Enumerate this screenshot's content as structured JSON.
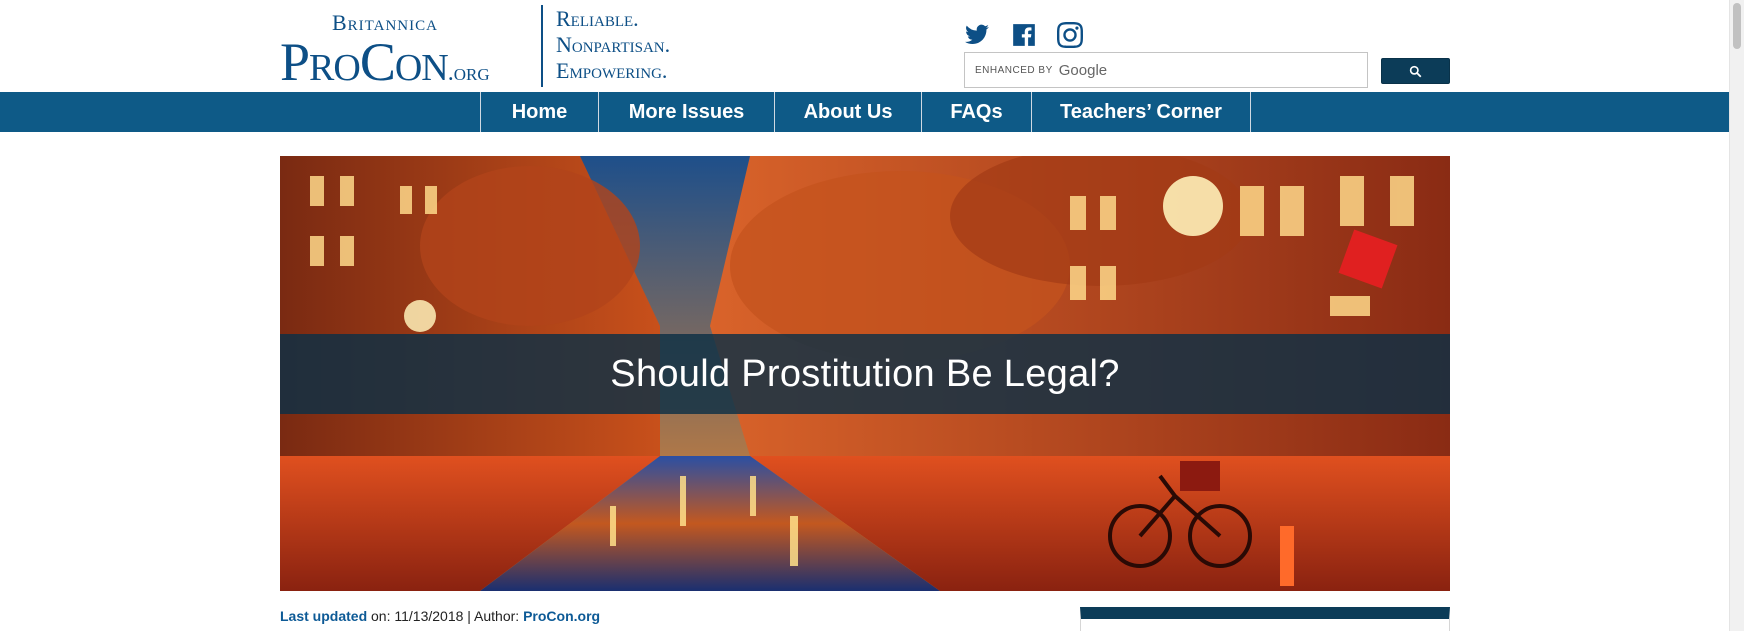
{
  "header": {
    "logo": {
      "top_text": "Britannica",
      "main_text": "ProCon",
      "suffix": ".org"
    },
    "tagline": [
      "Reliable.",
      "Nonpartisan.",
      "Empowering."
    ],
    "social": [
      {
        "icon": "twitter-icon"
      },
      {
        "icon": "facebook-icon"
      },
      {
        "icon": "instagram-icon"
      }
    ],
    "search": {
      "enhanced_by": "enhanced by",
      "provider": "Google",
      "button_icon": "search-icon"
    }
  },
  "nav": {
    "items": [
      {
        "label": "Home"
      },
      {
        "label": "More Issues"
      },
      {
        "label": "About Us"
      },
      {
        "label": "FAQs"
      },
      {
        "label": "Teachers’ Corner"
      }
    ]
  },
  "hero": {
    "title": "Should Prostitution Be Legal?"
  },
  "meta": {
    "updated_label": "Last updated",
    "updated_text": " on: 11/13/2018 | Author: ",
    "author": "ProCon.org"
  },
  "colors": {
    "brand_blue": "#0d4f86",
    "nav_blue": "#0e5a87",
    "dark_blue": "#0c3c58"
  }
}
